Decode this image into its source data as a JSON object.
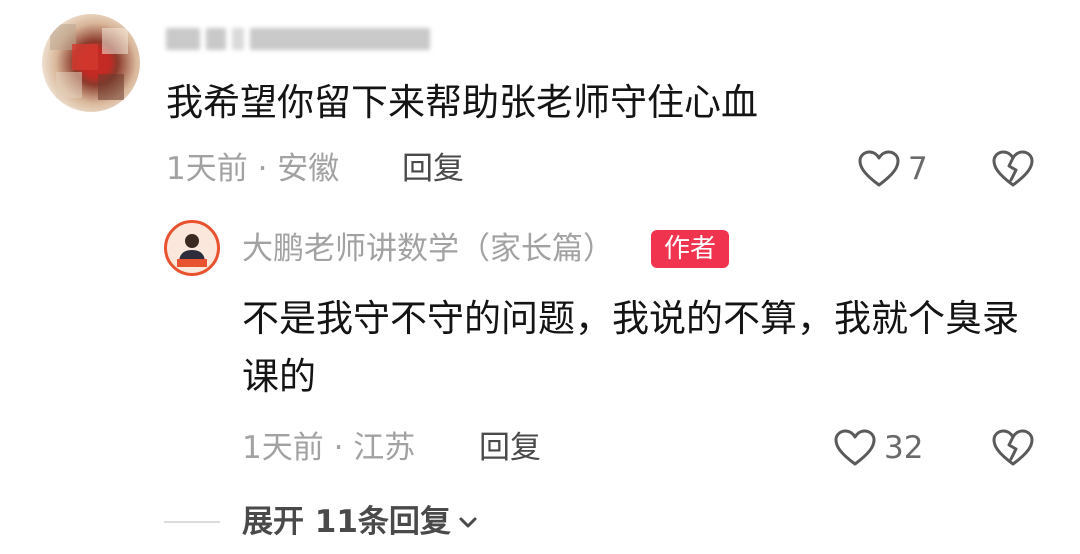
{
  "comment": {
    "username": "",
    "text": "我希望你留下来帮助张老师守住心血",
    "time_location": "1天前 · 安徽",
    "reply_label": "回复",
    "like_count": "7",
    "icons": {
      "like": "heart-outline-icon",
      "dislike": "broken-heart-icon"
    }
  },
  "author_reply": {
    "author_name": "大鹏老师讲数学（家长篇）",
    "badge": "作者",
    "text": "不是我守不守的问题，我说的不算，我就个臭录课的",
    "time_location": "1天前 · 江苏",
    "reply_label": "回复",
    "like_count": "32"
  },
  "expand_replies": {
    "label": "展开 11条回复",
    "icon": "chevron-down-icon"
  },
  "colors": {
    "text_primary": "#141414",
    "text_secondary": "#a2a2a2",
    "badge_bg": "#f0334f",
    "avatar_ring": "#e8522e"
  }
}
